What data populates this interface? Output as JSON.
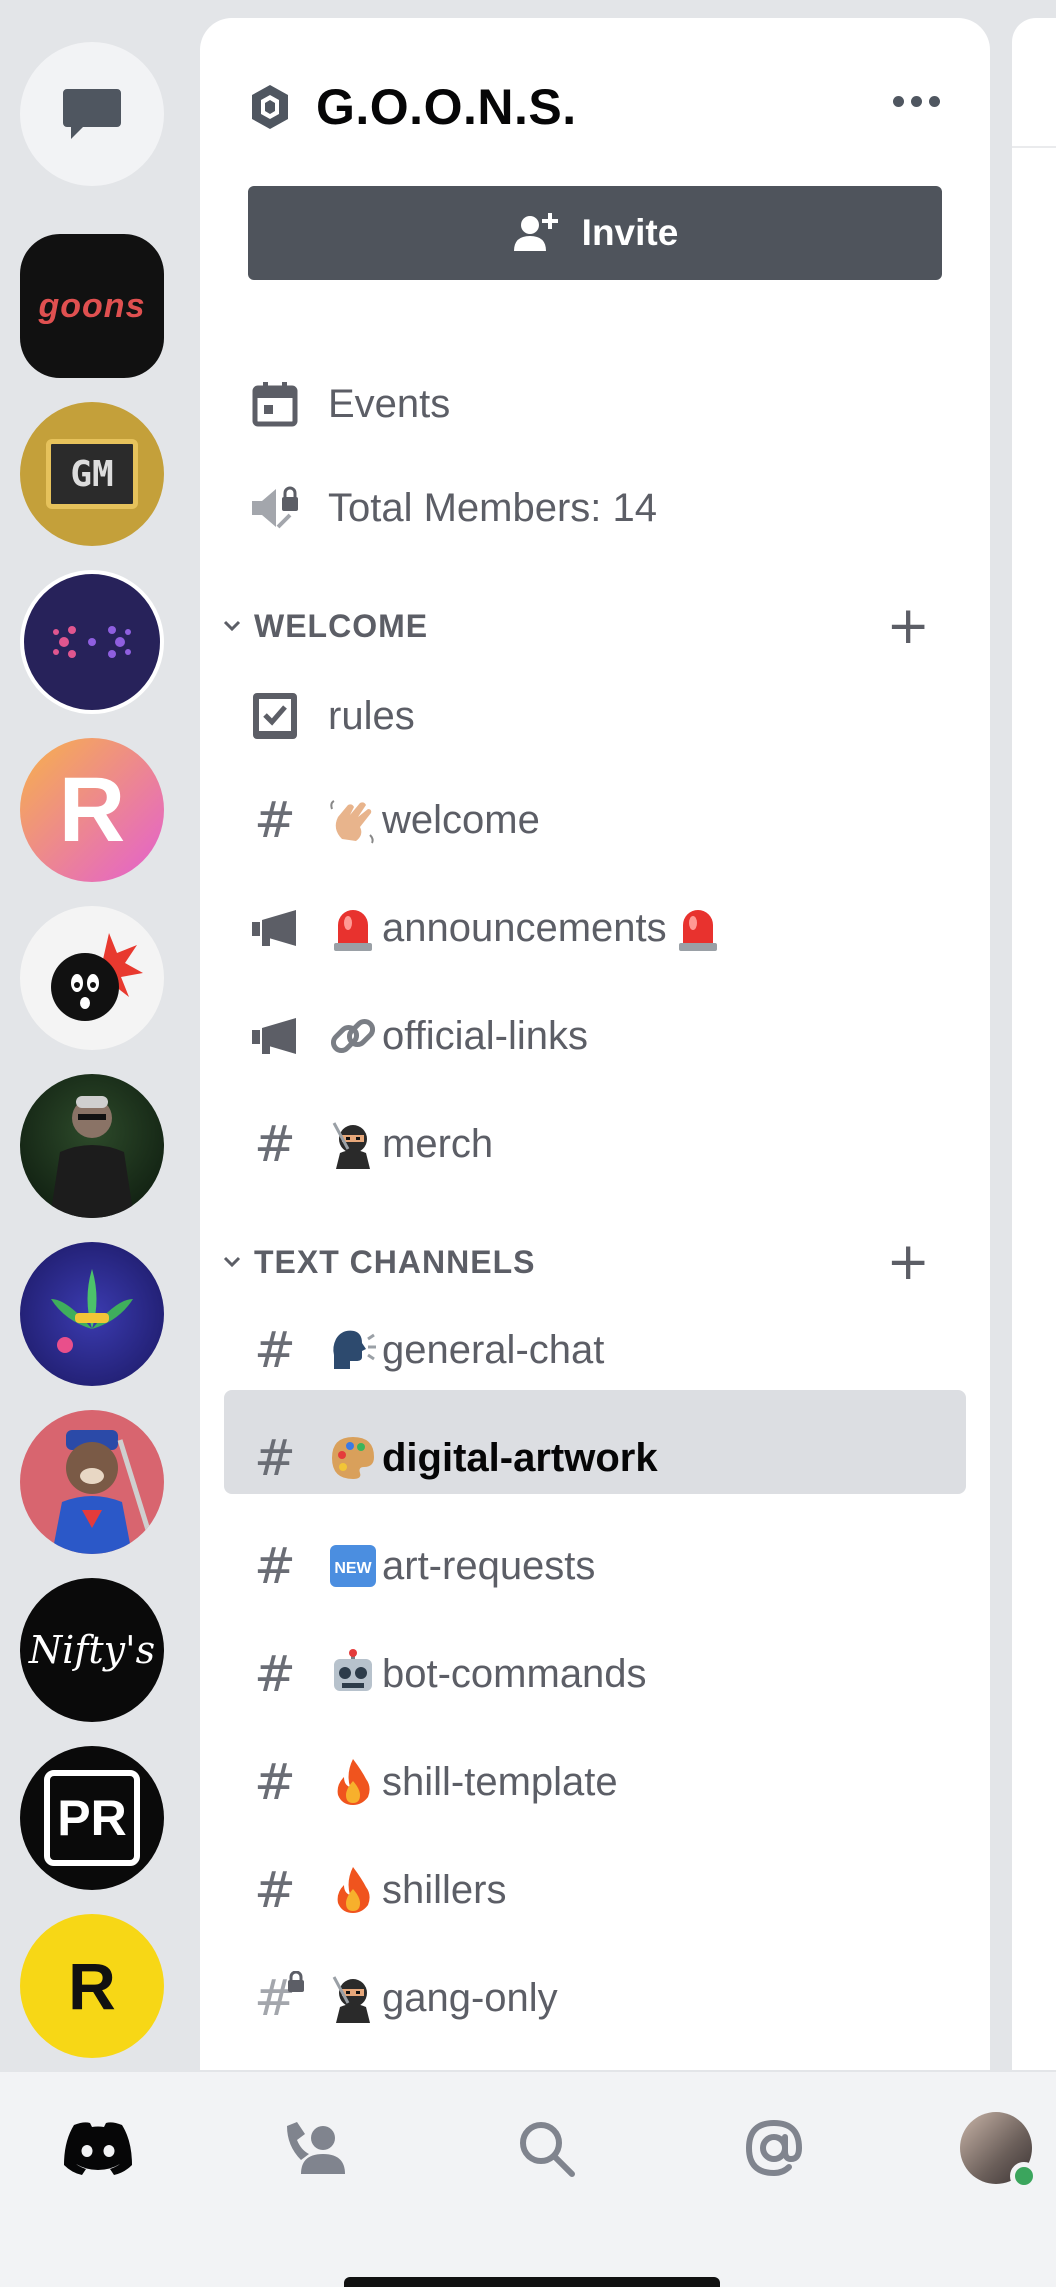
{
  "server": {
    "name": "G.O.O.N.S.",
    "invite_label": "Invite"
  },
  "rail": {
    "servers": [
      {
        "name": "goons-server",
        "text": "goons"
      },
      {
        "name": "gm-server",
        "text": "GM"
      },
      {
        "name": "infinity-server",
        "text": ""
      },
      {
        "name": "r-gradient-server",
        "text": "R"
      },
      {
        "name": "bomb-server",
        "text": ""
      },
      {
        "name": "matrix-server",
        "text": ""
      },
      {
        "name": "leaf-server",
        "text": ""
      },
      {
        "name": "superhero-server",
        "text": ""
      },
      {
        "name": "niftys-server",
        "text": "Nifty's"
      },
      {
        "name": "pr-server",
        "text": "PR"
      },
      {
        "name": "r-yellow-server",
        "text": "R"
      }
    ]
  },
  "top_items": [
    {
      "label": "Events",
      "icon": "calendar-icon"
    },
    {
      "label": "Total Members: 14",
      "icon": "locked-speaker-icon"
    }
  ],
  "categories": [
    {
      "label": "WELCOME",
      "channels": [
        {
          "label": "rules",
          "type": "rules",
          "emoji": ""
        },
        {
          "label": "welcome",
          "type": "text",
          "emoji": "wave"
        },
        {
          "label": "announcements",
          "type": "announcement",
          "emoji": "siren",
          "trailing_emoji": "siren"
        },
        {
          "label": "official-links",
          "type": "announcement",
          "emoji": "link"
        },
        {
          "label": "merch",
          "type": "text",
          "emoji": "ninja"
        }
      ]
    },
    {
      "label": "TEXT CHANNELS",
      "channels": [
        {
          "label": "general-chat",
          "type": "text",
          "emoji": "speaking-head"
        },
        {
          "label": "digital-artwork",
          "type": "text",
          "emoji": "palette",
          "selected": true
        },
        {
          "label": "art-requests",
          "type": "text",
          "emoji": "new"
        },
        {
          "label": "bot-commands",
          "type": "text",
          "emoji": "robot"
        },
        {
          "label": "shill-template",
          "type": "text",
          "emoji": "fire"
        },
        {
          "label": "shillers",
          "type": "text",
          "emoji": "fire"
        },
        {
          "label": "gang-only",
          "type": "locked-text",
          "emoji": "ninja"
        }
      ]
    }
  ],
  "nav": {
    "items": [
      "home-icon",
      "friends-icon",
      "search-icon",
      "mentions-icon",
      "profile-avatar"
    ],
    "status_color": "#3ba55d"
  },
  "colors": {
    "accent": "#4f545c",
    "selected": "#dcdee2",
    "text_muted": "#5c5e66"
  }
}
